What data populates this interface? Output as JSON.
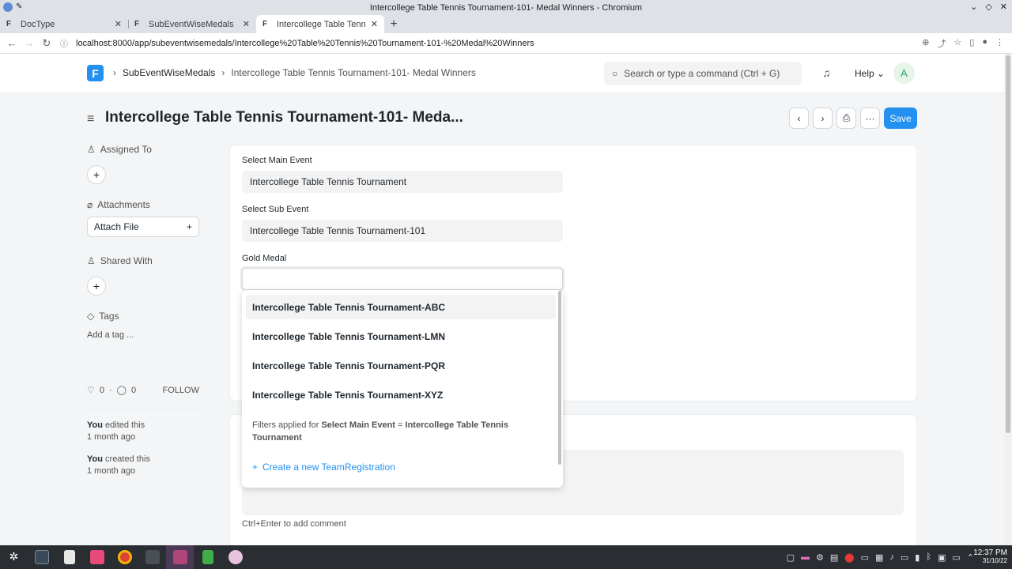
{
  "window": {
    "title": "Intercollege Table Tennis Tournament-101- Medal Winners - Chromium"
  },
  "tabs": [
    {
      "label": "DocType",
      "fav": "F"
    },
    {
      "label": "SubEventWiseMedals",
      "fav": "F"
    },
    {
      "label": "Intercollege Table Tennis To",
      "fav": "F"
    }
  ],
  "address": {
    "url": "localhost:8000/app/subeventwisemedals/Intercollege%20Table%20Tennis%20Tournament-101-%20Medal%20Winners"
  },
  "nav": {
    "logo": "F",
    "crumb1": "SubEventWiseMedals",
    "crumb2": "Intercollege Table Tennis Tournament-101- Medal Winners",
    "search_placeholder": "Search or type a command (Ctrl + G)",
    "help": "Help",
    "avatar": "A"
  },
  "page": {
    "title": "Intercollege Table Tennis Tournament-101- Meda...",
    "save": "Save",
    "more": "···"
  },
  "sidebar": {
    "assigned": "Assigned To",
    "attachments": "Attachments",
    "attach_file": "Attach File",
    "shared": "Shared With",
    "tags": "Tags",
    "add_tag": "Add a tag ...",
    "likes": "0",
    "comments": "0",
    "follow": "FOLLOW",
    "activity": [
      {
        "who": "You",
        "what": " edited this",
        "when": "1 month ago"
      },
      {
        "who": "You",
        "what": " created this",
        "when": "1 month ago"
      }
    ]
  },
  "form": {
    "main_label": "Select Main Event",
    "main_value": "Intercollege Table Tennis Tournament",
    "sub_label": "Select Sub Event",
    "sub_value": "Intercollege Table Tennis Tournament-101",
    "gold_label": "Gold Medal",
    "gold_value": ""
  },
  "dropdown": {
    "items": [
      "Intercollege Table Tennis Tournament-ABC",
      "Intercollege Table Tennis Tournament-LMN",
      "Intercollege Table Tennis Tournament-PQR",
      "Intercollege Table Tennis Tournament-XYZ"
    ],
    "filter_prefix": "Filters applied for ",
    "filter_field": "Select Main Event",
    "filter_eq": " = ",
    "filter_value": "Intercollege Table Tennis Tournament",
    "create": "Create a new TeamRegistration"
  },
  "comment": {
    "hint": "Ctrl+Enter to add comment"
  },
  "taskbar": {
    "time": "12:37 PM",
    "date": "31/10/22"
  }
}
